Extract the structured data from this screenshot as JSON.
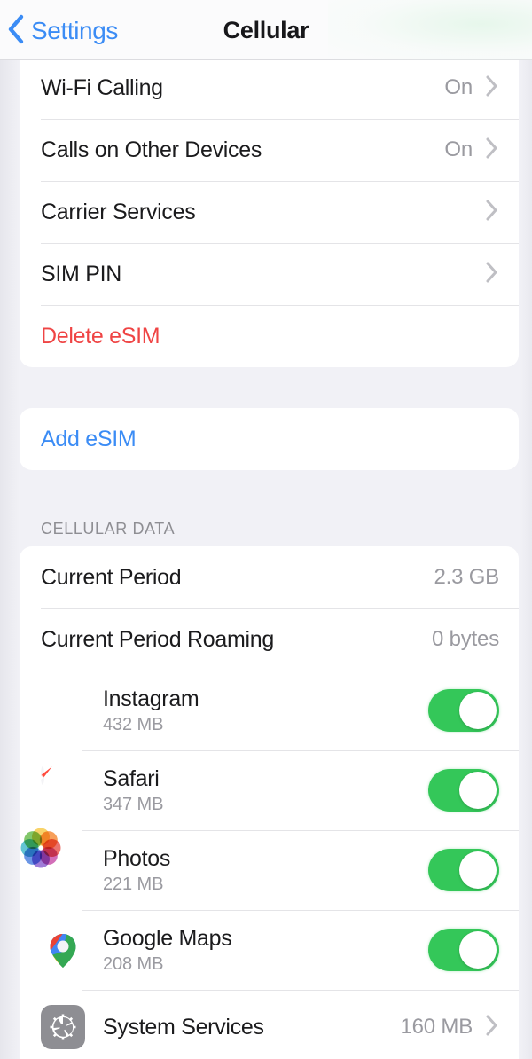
{
  "nav": {
    "back_label": "Settings",
    "back_icon": "chevron-left-icon",
    "title": "Cellular"
  },
  "colors": {
    "accent_blue": "#3b8cf5",
    "destructive_red": "#ef4444",
    "toggle_green": "#34c759",
    "page_background": "#f1f1f6",
    "card_background": "#ffffff",
    "secondary_text": "#9a9aa0"
  },
  "sections": {
    "sim": {
      "rows": [
        {
          "label": "Wi-Fi Calling",
          "value": "On",
          "accessory": "chevron-right-icon"
        },
        {
          "label": "Calls on Other Devices",
          "value": "On",
          "accessory": "chevron-right-icon"
        },
        {
          "label": "Carrier Services",
          "value": "",
          "accessory": "chevron-right-icon"
        },
        {
          "label": "SIM PIN",
          "value": "",
          "accessory": "chevron-right-icon"
        },
        {
          "label": "Delete eSIM",
          "value": "",
          "accessory": "none"
        }
      ]
    },
    "add_esim": {
      "rows": [
        {
          "label": "Add eSIM",
          "value": "",
          "accessory": "none"
        }
      ]
    },
    "cellular_data": {
      "header": "CELLULAR DATA",
      "summary_rows": [
        {
          "label": "Current Period",
          "value": "2.3 GB"
        },
        {
          "label": "Current Period Roaming",
          "value": "0 bytes"
        }
      ],
      "app_rows": [
        {
          "name": "Instagram",
          "size": "432 MB",
          "icon": "instagram-icon",
          "toggle": "on"
        },
        {
          "name": "Safari",
          "size": "347 MB",
          "icon": "safari-icon",
          "toggle": "on"
        },
        {
          "name": "Photos",
          "size": "221 MB",
          "icon": "photos-icon",
          "toggle": "on"
        },
        {
          "name": "Google Maps",
          "size": "208 MB",
          "icon": "google-maps-icon",
          "toggle": "on"
        }
      ],
      "system_row": {
        "name": "System Services",
        "value": "160 MB",
        "icon": "gear-icon",
        "accessory": "chevron-right-icon"
      }
    }
  }
}
